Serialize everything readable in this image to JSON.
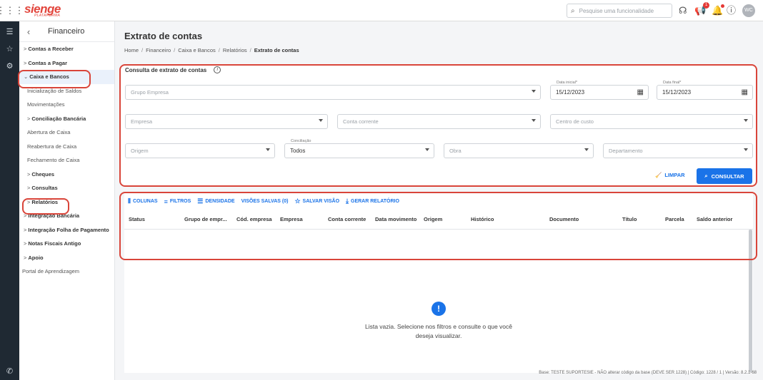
{
  "topbar": {
    "apps_icon": "grid-icon",
    "logo_brand": "sienge",
    "logo_sub": "PLATAFORMA",
    "search_placeholder": "Pesquise uma funcionalidade",
    "notification_count": "1",
    "avatar_initials": "WC"
  },
  "rail": {
    "icons": [
      "menu-collapse-icon",
      "star-icon",
      "gear-icon"
    ],
    "bottom_icon": "support-phone-icon"
  },
  "side": {
    "title": "Financeiro",
    "items": [
      {
        "label": "Contas a Receber",
        "kind": "group",
        "chevron": ">"
      },
      {
        "label": "Contas a Pagar",
        "kind": "group",
        "chevron": ">"
      },
      {
        "label": "Caixa e Bancos",
        "kind": "group-open",
        "chevron": "⌄"
      },
      {
        "label": "Inicialização de Saldos",
        "kind": "sub"
      },
      {
        "label": "Movimentações",
        "kind": "sub"
      },
      {
        "label": "Conciliação Bancária",
        "kind": "subgroup",
        "chevron": ">"
      },
      {
        "label": "Abertura de Caixa",
        "kind": "sub"
      },
      {
        "label": "Reabertura de Caixa",
        "kind": "sub"
      },
      {
        "label": "Fechamento de Caixa",
        "kind": "sub"
      },
      {
        "label": "Cheques",
        "kind": "subgroup",
        "chevron": ">"
      },
      {
        "label": "Consultas",
        "kind": "subgroup",
        "chevron": ">"
      },
      {
        "label": "Relatórios",
        "kind": "subgroup",
        "chevron": ">"
      },
      {
        "label": "Integração Bancária",
        "kind": "group",
        "chevron": ">"
      },
      {
        "label": "Integração Folha de Pagamento",
        "kind": "group",
        "chevron": ">"
      },
      {
        "label": "Notas Fiscais Antigo",
        "kind": "group",
        "chevron": ">"
      },
      {
        "label": "Apoio",
        "kind": "group",
        "chevron": ">"
      },
      {
        "label": "Portal de Aprendizagem",
        "kind": "plain"
      }
    ]
  },
  "main": {
    "title": "Extrato de contas",
    "breadcrumb": [
      "Home",
      "Financeiro",
      "Caixa e Bancos",
      "Relatórios",
      "Extrato de contas"
    ],
    "filters": {
      "title": "Consulta de extrato de contas",
      "grupo_empresa": "Grupo Empresa",
      "data_inicial_label": "Data inicial*",
      "data_inicial": "15/12/2023",
      "data_final_label": "Data final*",
      "data_final": "15/12/2023",
      "empresa": "Empresa",
      "conta_corrente": "Conta corrente",
      "centro_custo": "Centro de custo",
      "origem": "Origem",
      "conciliacao_label": "Conciliação",
      "conciliacao": "Todos",
      "obra": "Obra",
      "departamento": "Departamento",
      "clear_label": "LIMPAR",
      "query_label": "CONSULTAR"
    },
    "toolbar": {
      "colunas": "COLUNAS",
      "filtros": "FILTROS",
      "densidade": "DENSIDADE",
      "visoes": "VISÕES SALVAS (0)",
      "salvar": "SALVAR VISÃO",
      "gerar": "GERAR RELATÓRIO"
    },
    "columns": [
      "Status",
      "Grupo de empr...",
      "Cód. empresa",
      "Empresa",
      "Conta corrente",
      "Data movimento",
      "Origem",
      "Histórico",
      "Documento",
      "Título",
      "Parcela",
      "Saldo anterior"
    ],
    "empty_message": "Lista vazia. Selecione nos filtros e consulte o que você deseja visualizar."
  },
  "footer": "Base: TESTE SUPORTESIE - NÃO alterar código da base (DEVE SER 1228) | Código: 1228 / 1 | Versão: 8.2.1-68",
  "colors": {
    "accent": "#1a73e8",
    "brand": "#e2453c",
    "highlight": "#d9453a"
  }
}
